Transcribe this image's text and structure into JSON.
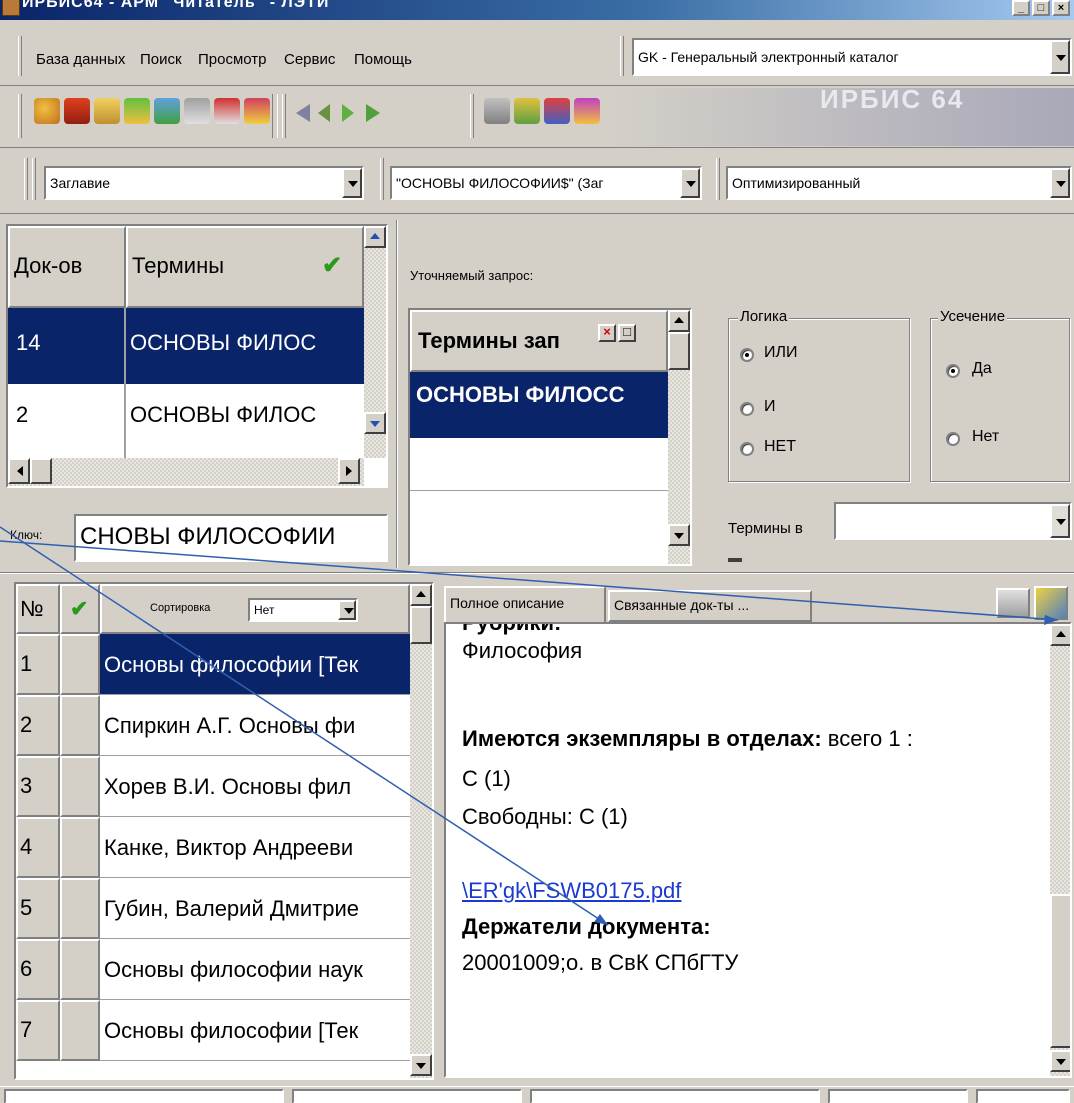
{
  "title": "ИРБИС64 - АРМ \"Читатель\" - ЛЭТИ",
  "menu": [
    "База данных",
    "Поиск",
    "Просмотр",
    "Сервис",
    "Помощь"
  ],
  "catalog_select": "GK - Генеральный электронный каталог",
  "toolbar_logo_text": "ИРБИС 64",
  "search_row": {
    "field": "Заглавие",
    "term": "\"ОСНОВЫ ФИЛОСОФИИ$\" (Заг",
    "mode": "Оптимизированный"
  },
  "terms_table": {
    "col_docs": "Док-ов",
    "col_terms": "Термины",
    "check_icon": "✔",
    "rows": [
      {
        "docs": "14",
        "term": "ОСНОВЫ ФИЛОС"
      },
      {
        "docs": "2",
        "term": "ОСНОВЫ ФИЛОС"
      }
    ],
    "key_label": "Ключ:",
    "key_value": "СНОВЫ ФИЛОСОФИИ"
  },
  "refine": {
    "label": "Уточняемый запрос:",
    "header": "Термины зап",
    "row": "ОСНОВЫ ФИЛОСС",
    "close": "×",
    "restore": "□",
    "logic_title": "Логика",
    "logic_options": [
      "ИЛИ",
      "И",
      "НЕТ"
    ],
    "trunc_title": "Усечение",
    "trunc_options": [
      "Да",
      "Нет"
    ],
    "terms_in_label": "Термины в",
    "terms_in_value": ""
  },
  "docs_table": {
    "col_num": "№",
    "check_icon": "✔",
    "sort_label": "Сортировка",
    "sort_value": "Нет",
    "rows": [
      {
        "n": "1",
        "text": "Основы философии [Тек"
      },
      {
        "n": "2",
        "text": "Спиркин А.Г. Основы фи"
      },
      {
        "n": "3",
        "text": "Хорев В.И. Основы фил"
      },
      {
        "n": "4",
        "text": "Канке, Виктор Андрееви"
      },
      {
        "n": "5",
        "text": "Губин, Валерий Дмитрие"
      },
      {
        "n": "6",
        "text": "Основы философии наук"
      },
      {
        "n": "7",
        "text": "Основы философии [Тек"
      }
    ]
  },
  "detail": {
    "tabs": [
      "Полное описание",
      "Связанные док-ты ..."
    ],
    "rubric_partial": "Рубрики:",
    "rubric_value": "Философия",
    "copies_label": "Имеются экземпляры в отделах:",
    "copies_value": " всего 1 :",
    "copies_dept": "С (1)",
    "free": "Свободны: С (1)",
    "link": "\\ER'gk\\FSWB0175.pdf",
    "holders_label": "Держатели документа:",
    "holders_value": "20001009;о. в СвК СПбГТУ"
  },
  "colors": {
    "selection": "#0a246a",
    "window_bg": "#d4d0c8",
    "link": "#1a3ad0",
    "annotation_line": "#2f5fb0"
  }
}
